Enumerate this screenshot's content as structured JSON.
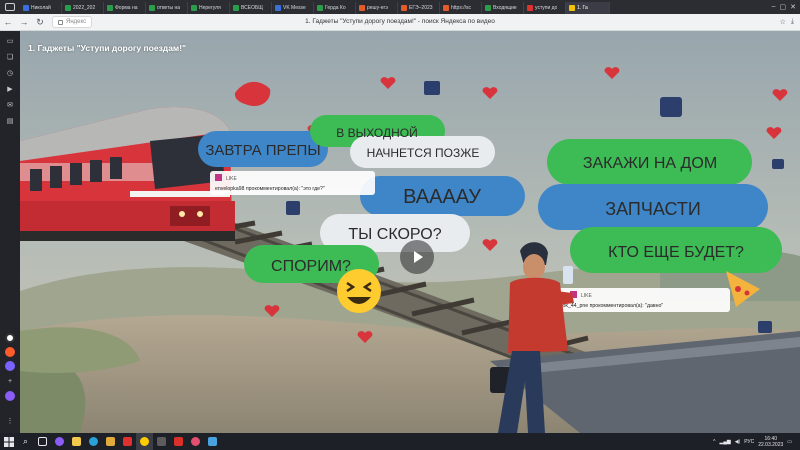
{
  "browser": {
    "tabs": [
      {
        "label": "Николай",
        "color": "#3b6fd9"
      },
      {
        "label": "2022_202",
        "color": "#2c9c4a"
      },
      {
        "label": "Форма на",
        "color": "#2c9c4a"
      },
      {
        "label": "ответы на",
        "color": "#2c9c4a"
      },
      {
        "label": "Нерегуля",
        "color": "#2c9c4a"
      },
      {
        "label": "ВСЕОБЩ",
        "color": "#2c9c4a"
      },
      {
        "label": "VK Messe",
        "color": "#3b6fd9"
      },
      {
        "label": "Герда Ко",
        "color": "#2c9c4a"
      },
      {
        "label": "решу-егэ",
        "color": "#e25b2a"
      },
      {
        "label": "ЕГЭ–2023",
        "color": "#e25b2a"
      },
      {
        "label": "https://sc",
        "color": "#e25b2a"
      },
      {
        "label": "Входящие",
        "color": "#2c9c4a"
      },
      {
        "label": "уступи до",
        "color": "#e03131"
      },
      {
        "label": "1. Га",
        "color": "#f5c400",
        "active": true
      }
    ],
    "address_host": "Яндекс",
    "page_title": "1. Гаджеты \"Уступи дорогу поездам!\" - поиск Яндекса по видео"
  },
  "video": {
    "title": "1. Гаджеты \"Уступи дорогу поездам!\"",
    "bubbles": {
      "b1": "ЗАВТРА ПРЕПЫ",
      "b2": "В ВЫХОДНОЙ",
      "b3": "НАЧНЕТСЯ ПОЗЖЕ",
      "b4": "ВААААУ",
      "b5": "ТЫ СКОРО?",
      "b6": "СПОРИМ?",
      "b7": "ЗАКАЖИ НА ДОМ",
      "b8": "ЗАПЧАСТИ",
      "b9": "КТО ЕЩЕ БУДЕТ?"
    },
    "comments": {
      "c1_like": "LIKE",
      "c1_text": "envelopka98 прокомментировал(а): \"это где?\"",
      "c2_like": "LIKE",
      "c2_text": "perok_44_pne прокомментировал(а): \"давно\""
    },
    "colors": {
      "green": "#3dbb55",
      "blue": "#3f86c9",
      "grey": "#e9ecef",
      "red": "#d8343c"
    }
  },
  "taskbar": {
    "lang": "РУС",
    "time": "16:40",
    "date": "22.03.2023"
  }
}
